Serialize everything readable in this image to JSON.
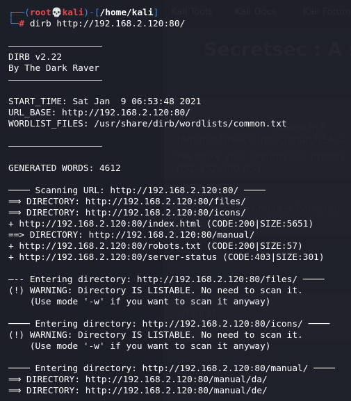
{
  "background": {
    "tabs": [
      "Kali Tools",
      "Kali Docs",
      "Kali Forum"
    ],
    "title": "Secretsec : A s",
    "texts": [
      "based in F",
      "(Albania,Greece,India,Japan,USA,C",
      "We make your security our priority",
      "052-452-990-054 .",
      "omputer Penetrati",
      "Hadi M"
    ]
  },
  "prompt": {
    "open": "┌──(",
    "user": "root💀kali",
    "mid": ")-[",
    "path": "/home/kali",
    "close": "]",
    "second": "└─",
    "hash": "# ",
    "command": "dirb http://192.168.2.120:80/"
  },
  "output": {
    "header_name": "DIRB v2.22",
    "header_author": "By The Dark Raver",
    "start_time": "START_TIME: Sat Jan  9 06:53:48 2021",
    "url_base": "URL_BASE: http://192.168.2.120:80/",
    "wordlist": "WORDLIST_FILES: /usr/share/dirb/wordlists/common.txt",
    "generated_words": "GENERATED WORDS: 4612",
    "scan_lines": [
      "──── Scanning URL: http://192.168.2.120:80/ ────",
      "⟹ DIRECTORY: http://192.168.2.120:80/files/",
      "⟹ DIRECTORY: http://192.168.2.120:80/icons/",
      "+ http://192.168.2.120:80/index.html (CODE:200|SIZE:5651)",
      "==> DIRECTORY: http://192.168.2.120:80/manual/",
      "+ http://192.168.2.120:80/robots.txt (CODE:200|SIZE:57)",
      "+ http://192.168.2.120:80/server-status (CODE:403|SIZE:301)"
    ],
    "files_block": [
      "—-- Entering directory: http://192.168.2.120:80/files/ ────",
      "(!) WARNING: Directory IS LISTABLE. No need to scan it.",
      "    (Use mode '-w' if you want to scan it anyway)"
    ],
    "icons_block": [
      "──── Entering directory: http://192.168.2.120:80/icons/ ────",
      "(!) WARNING: Directory IS LISTABLE. No need to scan it.",
      "    (Use mode '-w' if you want to scan it anyway)"
    ],
    "manual_block": [
      "──── Entering directory: http://192.168.2.120:80/manual/ ────",
      "⟹ DIRECTORY: http://192.168.2.120:80/manual/da/",
      "⟹ DIRECTORY: http://192.168.2.120:80/manual/de/"
    ]
  }
}
